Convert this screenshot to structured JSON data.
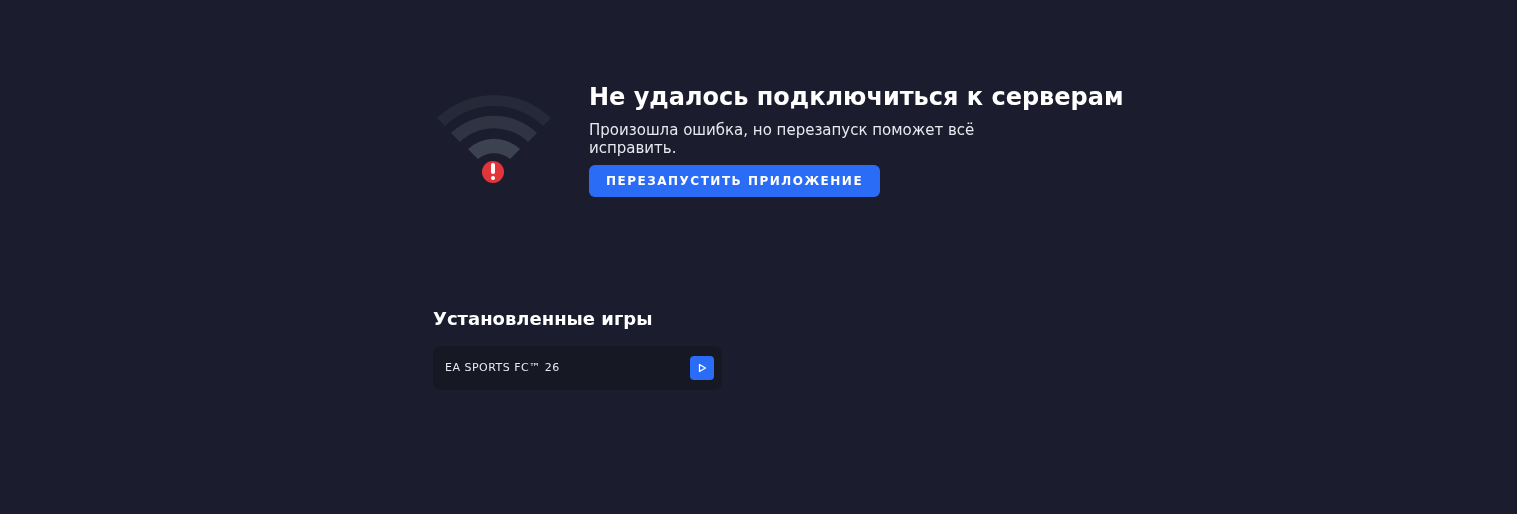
{
  "error": {
    "title": "Не удалось подключиться к серверам",
    "message": "Произошла ошибка, но перезапуск поможет всё исправить.",
    "button": "ПЕРЕЗАПУСТИТЬ ПРИЛОЖЕНИЕ"
  },
  "installed": {
    "heading": "Установленные игры",
    "games": [
      {
        "title": "EA SPORTS FC™ 26"
      }
    ]
  }
}
